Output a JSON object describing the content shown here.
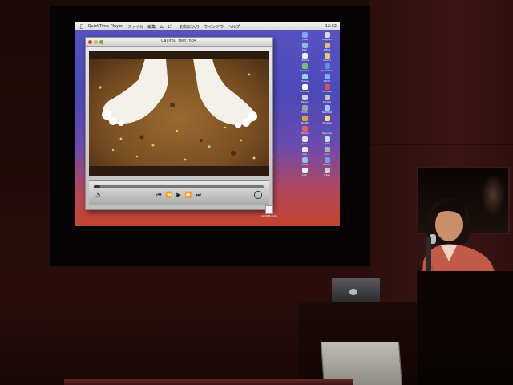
{
  "menubar": {
    "app": "QuickTime Player",
    "items": [
      "ファイル",
      "編集",
      "ムービー",
      "お気に入り",
      "ウインドウ",
      "ヘルプ"
    ],
    "clock": "12:32"
  },
  "player": {
    "title": "CaiJirou_feet.mp4",
    "progress": 0.04
  },
  "dock": {
    "icons": [
      {
        "label": "Finder",
        "color": "#7fa8e8"
      },
      {
        "label": "Graphic",
        "color": "#d8d8d8"
      },
      {
        "label": "Mail",
        "color": "#9ab5e0"
      },
      {
        "label": "Office",
        "color": "#e0c070"
      },
      {
        "label": "Photos",
        "color": "#f0f0f0"
      },
      {
        "label": "Sound",
        "color": "#e8d070"
      },
      {
        "label": "Preview",
        "color": "#70c070"
      },
      {
        "label": "QuickTime",
        "color": "#5a8ee8"
      },
      {
        "label": "iTunes",
        "color": "#8fd8f0"
      },
      {
        "label": "Safari",
        "color": "#80b0f0"
      },
      {
        "label": "Terminal",
        "color": "#ffffff"
      },
      {
        "label": "Acrobat",
        "color": "#e05050"
      },
      {
        "label": "Pages",
        "color": "#d0d0d0"
      },
      {
        "label": "Scripts",
        "color": "#c0c0c0"
      },
      {
        "label": "Prefs",
        "color": "#a0a0a0"
      },
      {
        "label": "Nightfall",
        "color": "#9fd0f0"
      },
      {
        "label": "Stuffit",
        "color": "#e0a040"
      },
      {
        "label": "Stickies",
        "color": "#f0e070"
      },
      {
        "label": "iMovie",
        "color": "#e06060"
      },
      {
        "label": "Keynote",
        "color": "#4060c0"
      },
      {
        "label": "Appl.",
        "color": "#e0e0e0"
      },
      {
        "label": "DVD",
        "color": "#c0e0f0"
      },
      {
        "label": "iCal",
        "color": "#e8e8e8"
      },
      {
        "label": "Sync",
        "color": "#b0b0b0"
      },
      {
        "label": "iChat",
        "color": "#90c0f0"
      },
      {
        "label": "iPhoto",
        "color": "#70a0e0"
      },
      {
        "label": "Calc",
        "color": "#f0f0f0"
      },
      {
        "label": "Trash",
        "color": "#d0d0d0"
      }
    ],
    "desktop_file": "123456.mov"
  }
}
